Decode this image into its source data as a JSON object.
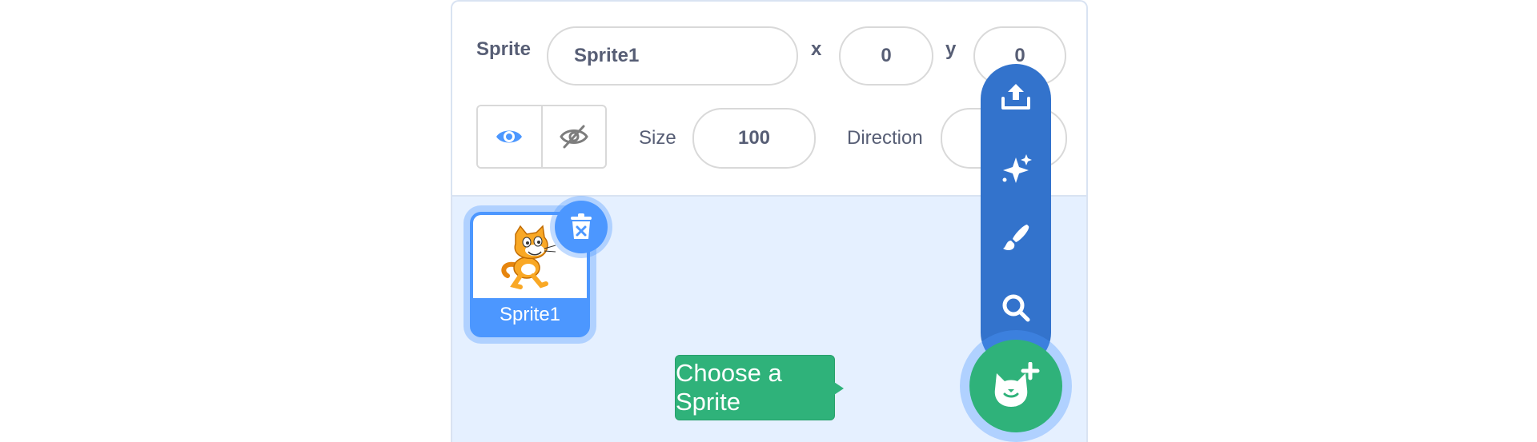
{
  "sprite_info": {
    "sprite_label": "Sprite",
    "sprite_name": "Sprite1",
    "x_label": "x",
    "x_value": "0",
    "y_label": "y",
    "y_value": "0",
    "show_label": "Show",
    "size_label": "Size",
    "size_value": "100",
    "direction_label": "Direction",
    "direction_value": ""
  },
  "sprites": [
    {
      "name": "Sprite1",
      "selected": true,
      "icon": "scratch-cat"
    }
  ],
  "sprite_menu": {
    "items": [
      {
        "name": "upload-sprite",
        "icon": "upload-icon"
      },
      {
        "name": "surprise",
        "icon": "sparkle-icon"
      },
      {
        "name": "paint",
        "icon": "paintbrush-icon"
      },
      {
        "name": "search",
        "icon": "search-icon"
      }
    ],
    "main_icon": "cat-plus-icon",
    "tooltip": "Choose a Sprite"
  },
  "colors": {
    "accent_blue": "#4c97ff",
    "menu_blue": "#3373cc",
    "add_green": "#2fb27a",
    "panel_bg": "#e5f0ff"
  }
}
